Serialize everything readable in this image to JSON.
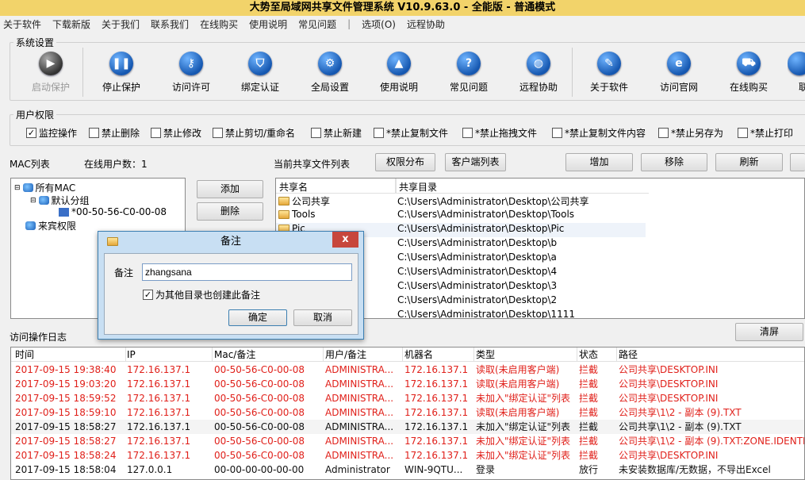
{
  "title": "大势至局域网共享文件管理系统 V10.9.63.0 - 全能版 - 普通模式",
  "menu": [
    "关于软件",
    "下载新版",
    "关于我们",
    "联系我们",
    "在线购买",
    "使用说明",
    "常见问题",
    "|",
    "选项(O)",
    "远程协助"
  ],
  "system_group": "系统设置",
  "toolbar": [
    {
      "label": "启动保护",
      "icon": "play-icon",
      "glyph": "▶",
      "disabled": true
    },
    {
      "label": "停止保护",
      "icon": "pause-icon",
      "glyph": "❚❚"
    },
    {
      "label": "访问许可",
      "icon": "key-icon",
      "glyph": "⚷"
    },
    {
      "label": "绑定认证",
      "icon": "shield-icon",
      "glyph": "⛉"
    },
    {
      "label": "全局设置",
      "icon": "gear-icon",
      "glyph": "⚙"
    },
    {
      "label": "使用说明",
      "icon": "graduation-cap-icon",
      "glyph": "▲"
    },
    {
      "label": "常见问题",
      "icon": "question-icon",
      "glyph": "?"
    },
    {
      "label": "远程协助",
      "icon": "globe-icon",
      "glyph": "◍"
    },
    {
      "label": "关于软件",
      "icon": "pen-icon",
      "glyph": "✎"
    },
    {
      "label": "访问官网",
      "icon": "browser-e-icon",
      "glyph": "e"
    },
    {
      "label": "在线购买",
      "icon": "cart-icon",
      "glyph": "⛟"
    },
    {
      "label": "联",
      "icon": "contact-icon",
      "glyph": ""
    }
  ],
  "user_group": "用户权限",
  "permissions": [
    {
      "label": "监控操作",
      "checked": true
    },
    {
      "label": "禁止删除",
      "checked": false
    },
    {
      "label": "禁止修改",
      "checked": false
    },
    {
      "label": "禁止剪切/重命名",
      "checked": false
    },
    {
      "label": "禁止新建",
      "checked": false
    },
    {
      "label": "*禁止复制文件",
      "checked": false
    },
    {
      "label": "*禁止拖拽文件",
      "checked": false
    },
    {
      "label": "*禁止复制文件内容",
      "checked": false
    },
    {
      "label": "*禁止另存为",
      "checked": false
    },
    {
      "label": "*禁止打印",
      "checked": false
    }
  ],
  "mac_list_label": "MAC列表",
  "online_users_label": "在线用户数：1",
  "tree": [
    "所有MAC",
    "默认分组",
    "*00-50-56-C0-00-08",
    "来宾权限"
  ],
  "add_label": "添加",
  "delete_label": "删除",
  "share_list_label": "当前共享文件列表",
  "btn_perm_dist": "权限分布",
  "btn_client_list": "客户端列表",
  "btn_add": "增加",
  "btn_remove": "移除",
  "btn_refresh": "刷新",
  "share_headers": [
    "共享名",
    "共享目录"
  ],
  "shares": [
    {
      "name": "公司共享",
      "path": "C:\\Users\\Administrator\\Desktop\\公司共享"
    },
    {
      "name": "Tools",
      "path": "C:\\Users\\Administrator\\Desktop\\Tools"
    },
    {
      "name": "Pic",
      "path": "C:\\Users\\Administrator\\Desktop\\Pic"
    },
    {
      "name": "",
      "path": "C:\\Users\\Administrator\\Desktop\\b"
    },
    {
      "name": "",
      "path": "C:\\Users\\Administrator\\Desktop\\a"
    },
    {
      "name": "",
      "path": "C:\\Users\\Administrator\\Desktop\\4"
    },
    {
      "name": "",
      "path": "C:\\Users\\Administrator\\Desktop\\3"
    },
    {
      "name": "",
      "path": "C:\\Users\\Administrator\\Desktop\\2"
    },
    {
      "name": "",
      "path": "C:\\Users\\Administrator\\Desktop\\1111"
    }
  ],
  "log_label": "访问操作日志",
  "clear_label": "清屏",
  "log_headers": [
    "时间",
    "IP",
    "Mac/备注",
    "用户/备注",
    "机器名",
    "类型",
    "状态",
    "路径"
  ],
  "logs": [
    [
      "2017-09-15 19:38:40",
      "172.16.137.1",
      "00-50-56-C0-00-08",
      "ADMINISTRA...",
      "172.16.137.1",
      "读取(未启用客户端)",
      "拦截",
      "公司共享\\DESKTOP.INI",
      "red"
    ],
    [
      "2017-09-15 19:03:20",
      "172.16.137.1",
      "00-50-56-C0-00-08",
      "ADMINISTRA...",
      "172.16.137.1",
      "读取(未启用客户端)",
      "拦截",
      "公司共享\\DESKTOP.INI",
      "red"
    ],
    [
      "2017-09-15 18:59:52",
      "172.16.137.1",
      "00-50-56-C0-00-08",
      "ADMINISTRA...",
      "172.16.137.1",
      "未加入\"绑定认证\"列表",
      "拦截",
      "公司共享\\DESKTOP.INI",
      "red"
    ],
    [
      "2017-09-15 18:59:10",
      "172.16.137.1",
      "00-50-56-C0-00-08",
      "ADMINISTRA...",
      "172.16.137.1",
      "读取(未启用客户端)",
      "拦截",
      "公司共享\\1\\2 - 副本 (9).TXT",
      "red"
    ],
    [
      "2017-09-15 18:58:27",
      "172.16.137.1",
      "00-50-56-C0-00-08",
      "ADMINISTRA...",
      "172.16.137.1",
      "未加入\"绑定认证\"列表",
      "拦截",
      "公司共享\\1\\2 - 副本 (9).TXT",
      "black"
    ],
    [
      "2017-09-15 18:58:27",
      "172.16.137.1",
      "00-50-56-C0-00-08",
      "ADMINISTRA...",
      "172.16.137.1",
      "未加入\"绑定认证\"列表",
      "拦截",
      "公司共享\\1\\2 - 副本 (9).TXT:ZONE.IDENTIF",
      "red"
    ],
    [
      "2017-09-15 18:58:24",
      "172.16.137.1",
      "00-50-56-C0-00-08",
      "ADMINISTRA...",
      "172.16.137.1",
      "未加入\"绑定认证\"列表",
      "拦截",
      "公司共享\\DESKTOP.INI",
      "red"
    ],
    [
      "2017-09-15 18:58:04",
      "127.0.0.1",
      "00-00-00-00-00-00",
      "Administrator",
      "WIN-9QTU...",
      "登录",
      "放行",
      "未安装数据库/无数据，不导出Excel",
      "black"
    ]
  ],
  "dialog": {
    "title": "备注",
    "label": "备注",
    "value": "zhangsana",
    "checkbox": "为其他目录也创建此备注",
    "checked": true,
    "ok": "确定",
    "cancel": "取消",
    "close": "x"
  }
}
